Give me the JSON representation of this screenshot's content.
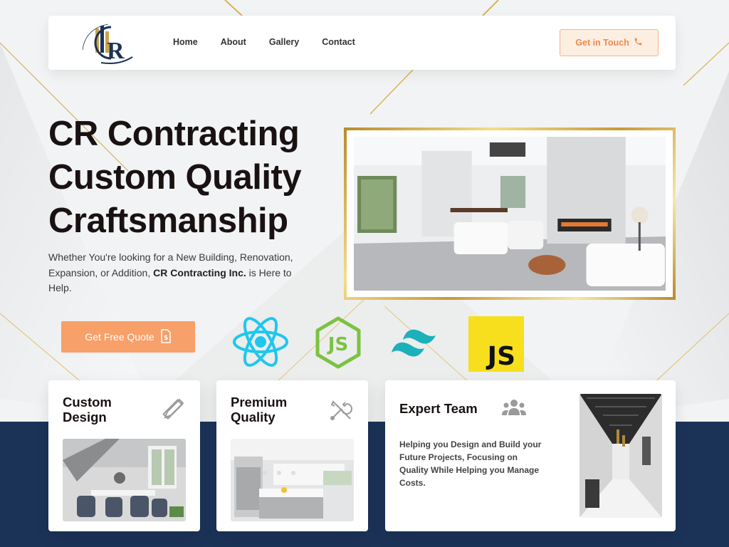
{
  "navbar": {
    "logo": {
      "name": "CR Contracting logo",
      "lettering": "CONTRACTING INC.",
      "initials": "CR"
    },
    "links": [
      {
        "label": "Home"
      },
      {
        "label": "About"
      },
      {
        "label": "Gallery"
      },
      {
        "label": "Contact"
      }
    ],
    "cta": {
      "label": "Get in Touch",
      "icon": "phone-icon"
    }
  },
  "hero": {
    "title_lines": [
      "CR Contracting",
      "Custom Quality",
      "Craftsmanship"
    ],
    "description_pre": "Whether You're looking for a New Building, Renovation, Expansion, or Addition, ",
    "description_bold": "CR Contracting Inc.",
    "description_post": " is Here to Help.",
    "quote_button": {
      "label": "Get Free Quote",
      "icon": "invoice-dollar-icon"
    },
    "image": {
      "icon": "living-room-photo"
    }
  },
  "tech_logos": [
    {
      "icon": "react-logo"
    },
    {
      "icon": "nodejs-logo",
      "text": "JS"
    },
    {
      "icon": "tailwind-logo"
    },
    {
      "icon": "javascript-logo",
      "text": "JS"
    }
  ],
  "cards": [
    {
      "title_lines": [
        "Custom",
        "Design"
      ],
      "icon": "pencil-ruler-icon",
      "image": "dining-room-photo"
    },
    {
      "title_lines": [
        "Premium",
        "Quality"
      ],
      "icon": "tools-icon",
      "image": "kitchen-photo"
    },
    {
      "title": "Expert Team",
      "icon": "users-icon",
      "description": "Helping you Design and Build your Future Projects, Focusing on Quality While Helping you Manage Costs.",
      "image": "hallway-photo"
    }
  ],
  "colors": {
    "accent_orange": "#f7a06a",
    "navy": "#1c3358",
    "gold": "#d4aa4a",
    "text_dark": "#1a1212",
    "react": "#1fc7ef",
    "node": "#7cc242",
    "js_yellow": "#f7df1e"
  }
}
